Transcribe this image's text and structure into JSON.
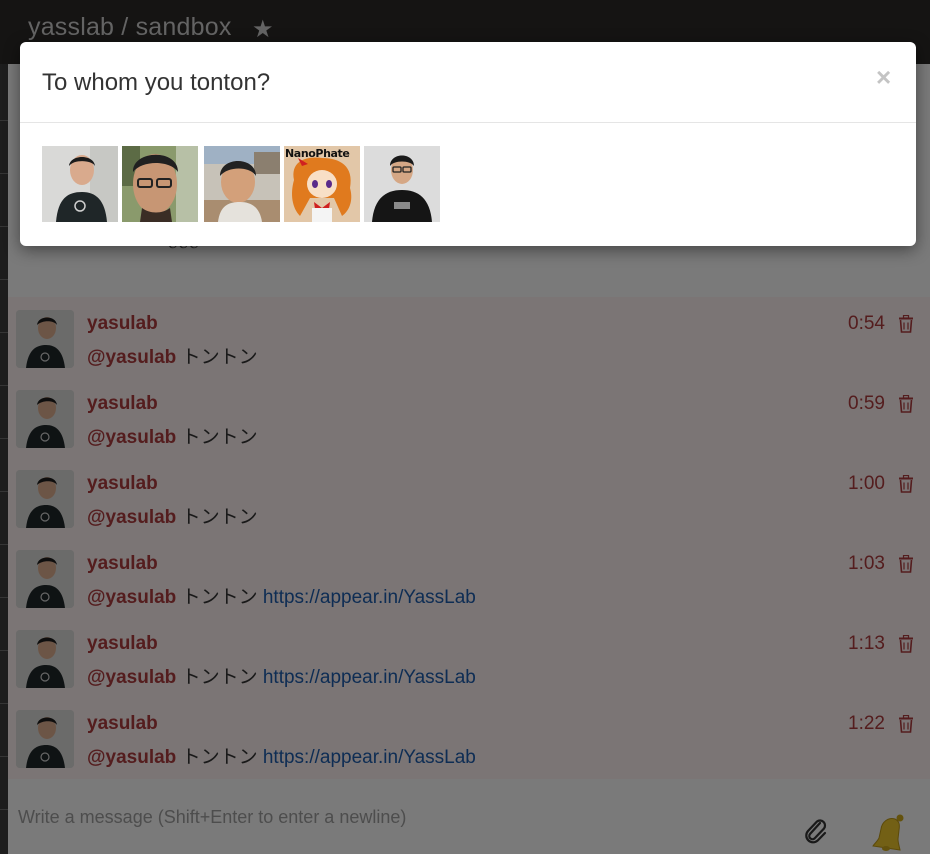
{
  "header": {
    "title": "yasslab / sandbox",
    "star_icon": "star-icon"
  },
  "background": {
    "partial_text": "ℯℯℯ"
  },
  "messages": [
    {
      "user": "yasulab",
      "mention": "@yasulab",
      "text": " トントン",
      "link": "",
      "time": "0:54"
    },
    {
      "user": "yasulab",
      "mention": "@yasulab",
      "text": " トントン",
      "link": "",
      "time": "0:59"
    },
    {
      "user": "yasulab",
      "mention": "@yasulab",
      "text": " トントン",
      "link": "",
      "time": "1:00"
    },
    {
      "user": "yasulab",
      "mention": "@yasulab",
      "text": " トントン ",
      "link": "https://appear.in/YassLab",
      "time": "1:03"
    },
    {
      "user": "yasulab",
      "mention": "@yasulab",
      "text": " トントン ",
      "link": "https://appear.in/YassLab",
      "time": "1:13"
    },
    {
      "user": "yasulab",
      "mention": "@yasulab",
      "text": " トントン ",
      "link": "https://appear.in/YassLab",
      "time": "1:22"
    }
  ],
  "composer": {
    "placeholder": "Write a message (Shift+Enter to enter a newline)",
    "attach_icon": "paperclip-icon",
    "notify_icon": "bell-icon"
  },
  "modal": {
    "title": "To whom you tonton?",
    "close_label": "×",
    "candidates": [
      {
        "kind": "photo",
        "icon": "avatar-1"
      },
      {
        "kind": "photo",
        "icon": "avatar-2"
      },
      {
        "kind": "photo",
        "icon": "avatar-3"
      },
      {
        "kind": "anime",
        "label": "NanoPhate"
      },
      {
        "kind": "photo",
        "icon": "avatar-5"
      }
    ]
  },
  "colors": {
    "accent": "#a93a3c",
    "link": "#1d5aa8",
    "header_bg": "#2a2826",
    "message_bg": "#f6eaea"
  }
}
